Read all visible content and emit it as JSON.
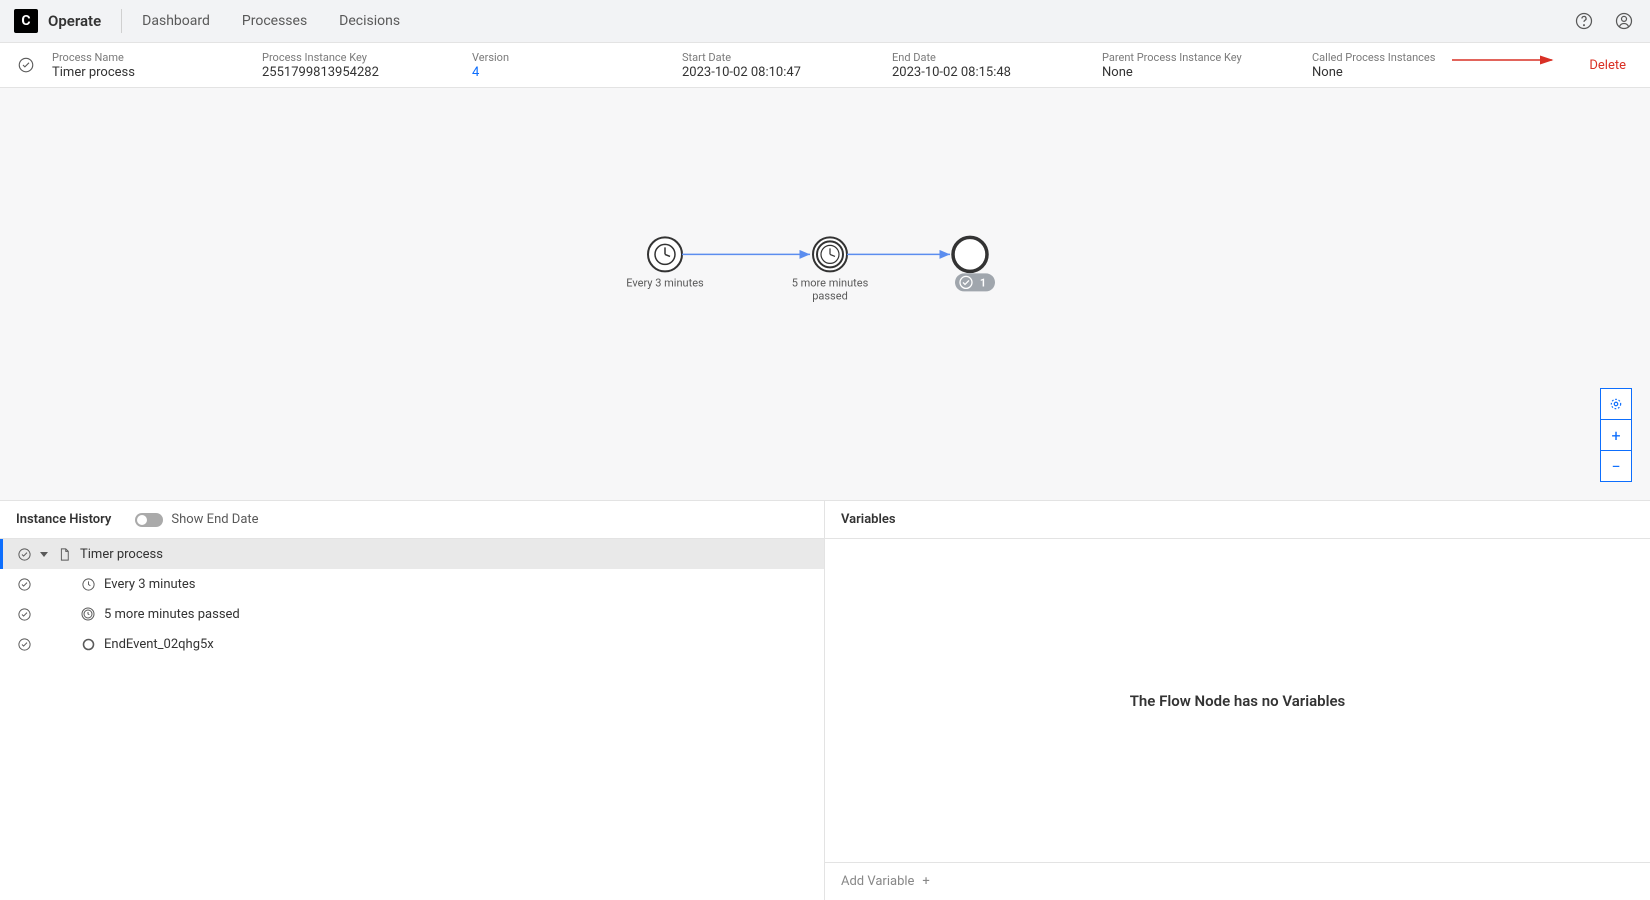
{
  "brand": {
    "icon_letter": "C",
    "label": "Operate"
  },
  "nav": {
    "dashboard": "Dashboard",
    "processes": "Processes",
    "decisions": "Decisions"
  },
  "instance": {
    "process_name_label": "Process Name",
    "process_name": "Timer process",
    "instance_key_label": "Process Instance Key",
    "instance_key": "2551799813954282",
    "version_label": "Version",
    "version": "4",
    "start_label": "Start Date",
    "start": "2023-10-02 08:10:47",
    "end_label": "End Date",
    "end": "2023-10-02 08:15:48",
    "parent_label": "Parent Process Instance Key",
    "parent": "None",
    "called_label": "Called Process Instances",
    "called": "None",
    "delete": "Delete"
  },
  "diagram": {
    "start_label": "Every 3 minutes",
    "mid_label_1": "5 more minutes",
    "mid_label_2": "passed",
    "end_badge_count": "1"
  },
  "history": {
    "title": "Instance History",
    "toggle_label": "Show End Date",
    "rows": [
      {
        "label": "Timer process",
        "type": "process",
        "selected": true
      },
      {
        "label": "Every 3 minutes",
        "type": "timer"
      },
      {
        "label": "5 more minutes passed",
        "type": "timer-inter"
      },
      {
        "label": "EndEvent_02qhg5x",
        "type": "end"
      }
    ]
  },
  "variables": {
    "title": "Variables",
    "empty": "The Flow Node has no Variables",
    "add": "Add Variable"
  }
}
